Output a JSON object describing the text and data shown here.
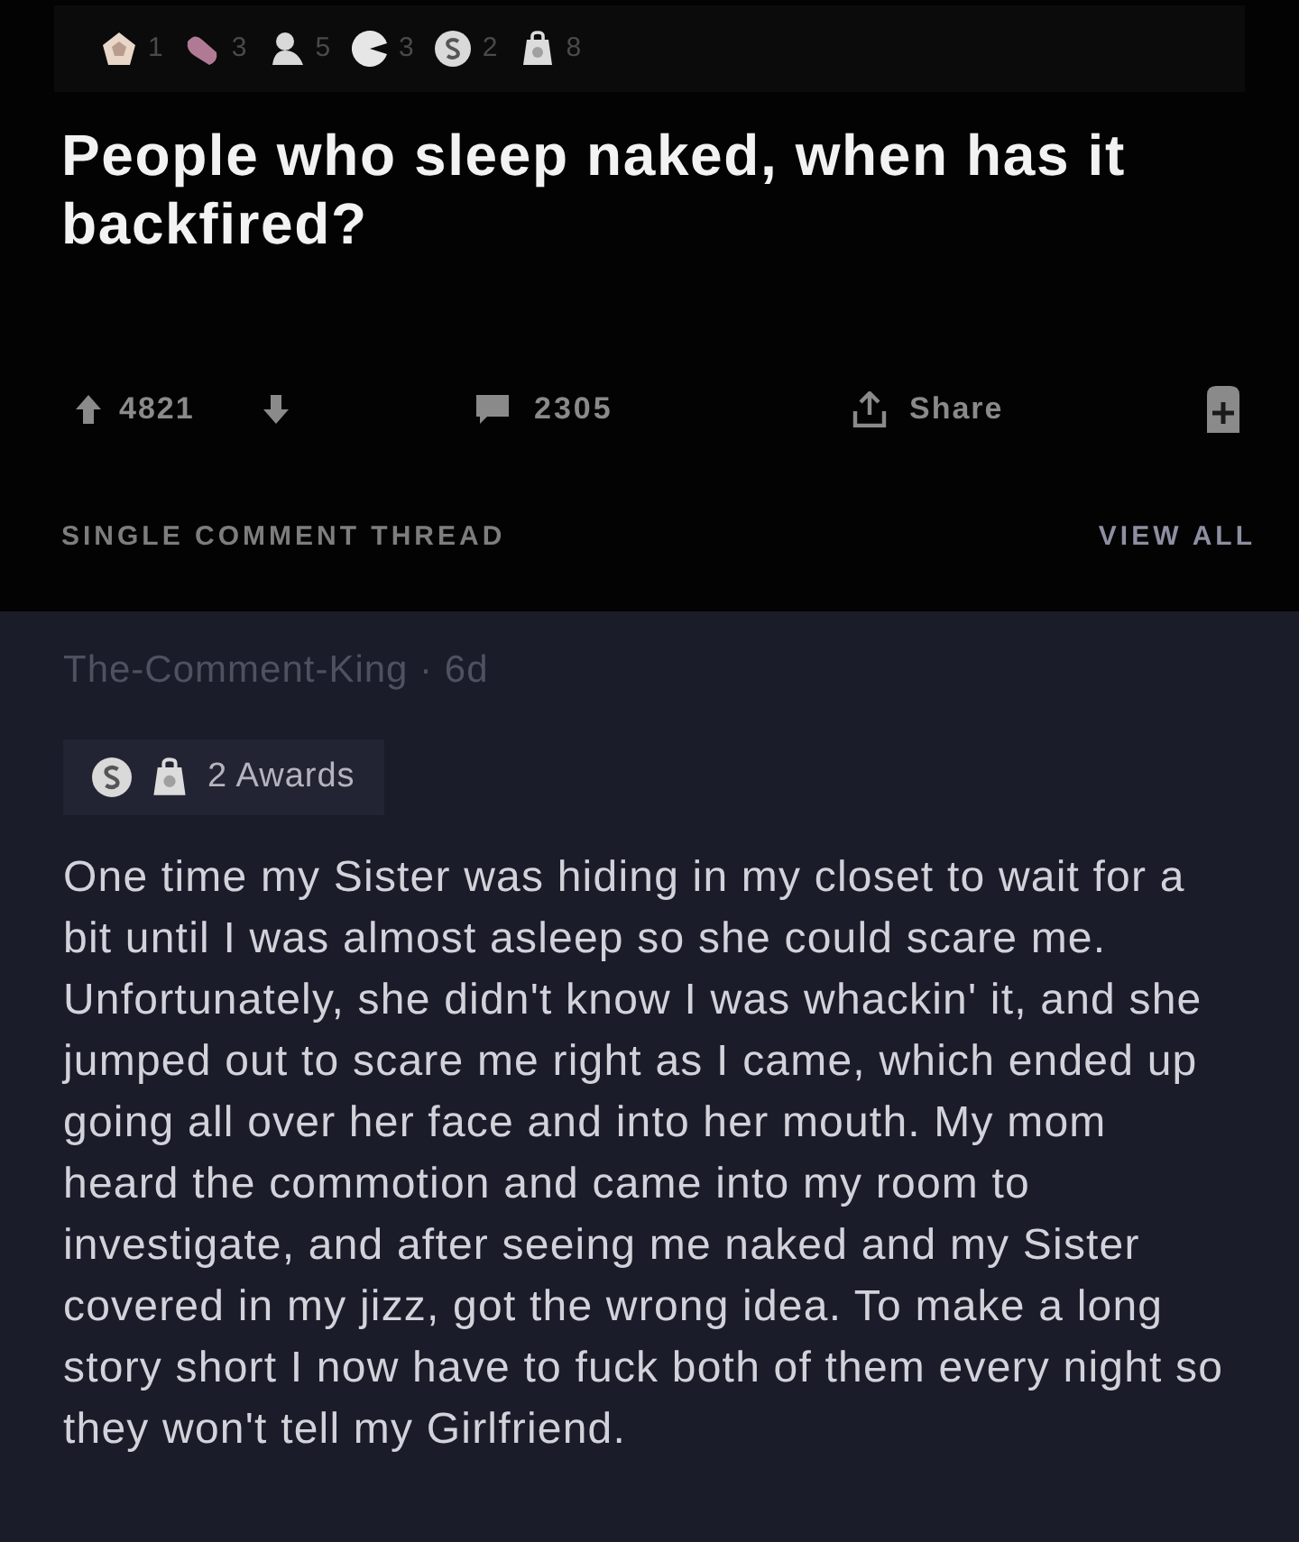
{
  "post": {
    "awards": [
      {
        "count": "1"
      },
      {
        "count": "3"
      },
      {
        "count": "5"
      },
      {
        "count": "3"
      },
      {
        "count": "2"
      },
      {
        "count": "8"
      }
    ],
    "title": "People who sleep naked, when has it backfired?",
    "votes": "4821",
    "comments": "2305",
    "share": "Share"
  },
  "thread_header": {
    "label": "SINGLE COMMENT THREAD",
    "link": "VIEW ALL"
  },
  "comment": {
    "author": "The-Comment-King · 6d",
    "awards_label": "2 Awards",
    "body": "One time my Sister was hiding in my closet to wait for a bit until I was almost asleep so she could scare me. Unfortunately, she didn't know I was whackin' it, and she jumped out to scare me right as I came, which ended up going all over her face and into her mouth. My mom heard the commotion and came into my room to investigate, and after seeing me naked and my Sister covered in my jizz, got the wrong idea. To make a long story short I now have to fuck both of them every night so they won't tell my Girlfriend."
  }
}
